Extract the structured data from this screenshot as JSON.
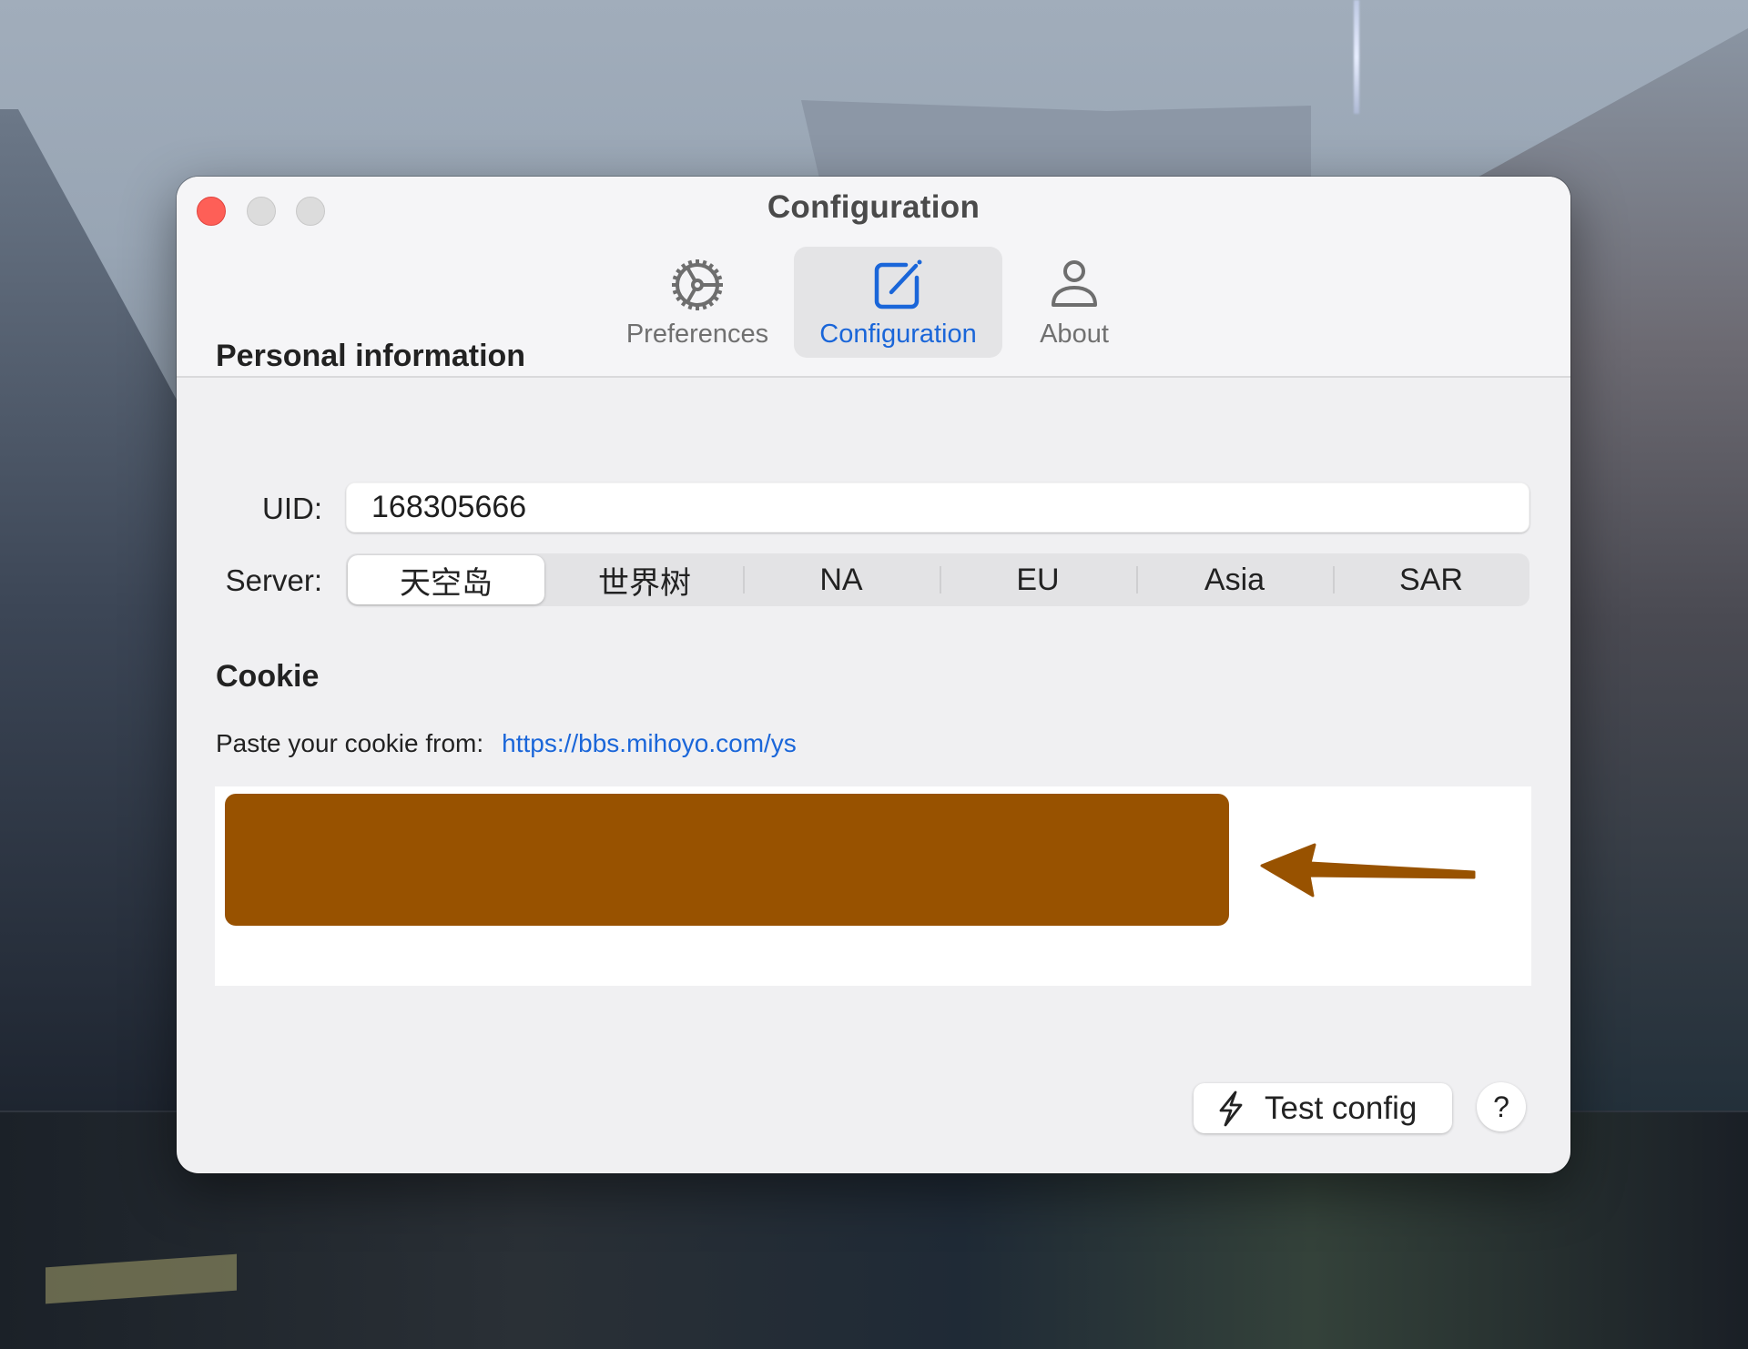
{
  "window": {
    "title": "Configuration",
    "controls": [
      "close",
      "minimize",
      "zoom"
    ]
  },
  "toolbar": {
    "tabs": [
      {
        "label": "Preferences",
        "icon": "gear-icon",
        "active": false
      },
      {
        "label": "Configuration",
        "icon": "square-pencil-icon",
        "active": true
      },
      {
        "label": "About",
        "icon": "person-icon",
        "active": false
      }
    ]
  },
  "personal": {
    "heading": "Personal information",
    "uid_label": "UID:",
    "uid_value": "168305666",
    "server_label": "Server:",
    "servers": [
      "天空岛",
      "世界树",
      "NA",
      "EU",
      "Asia",
      "SAR"
    ],
    "selected_server": "天空岛"
  },
  "cookie": {
    "heading": "Cookie",
    "hint": "Paste your cookie from:",
    "link": "https://bbs.mihoyo.com/ys",
    "redaction_color": "#985200"
  },
  "actions": {
    "test_label": "Test config",
    "help_label": "?"
  },
  "colors": {
    "accent": "#1a66d9",
    "close": "#fe5f57"
  }
}
